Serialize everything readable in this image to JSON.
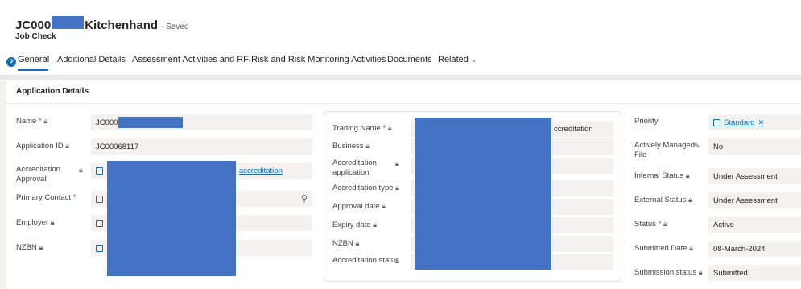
{
  "header": {
    "title_prefix": "JC000",
    "title_suffix": "Kitchenhand",
    "saved_status": "- Saved",
    "subtitle": "Job Check"
  },
  "tabs": [
    {
      "label": "General",
      "active": true
    },
    {
      "label": "Additional Details",
      "active": false
    },
    {
      "label": "Assessment Activities and RFI",
      "active": false
    },
    {
      "label": "Risk and Risk Monitoring Activities",
      "active": false
    },
    {
      "label": "Documents",
      "active": false
    },
    {
      "label": "Related",
      "active": false
    }
  ],
  "section": {
    "title": "Application Details"
  },
  "left_fields": {
    "name": {
      "label": "Name",
      "value": "JC000"
    },
    "application_id": {
      "label": "Application ID",
      "value": "JC00068117"
    },
    "accreditation_approval": {
      "label": "Accreditation Approval",
      "value": "accreditation"
    },
    "primary_contact": {
      "label": "Primary Contact"
    },
    "employer": {
      "label": "Employer"
    },
    "nzbn": {
      "label": "NZBN"
    }
  },
  "mid_fields": {
    "trading_name": {
      "label": "Trading Name",
      "value": "ccreditation"
    },
    "business": {
      "label": "Business"
    },
    "accreditation_application": {
      "label": "Accreditation application"
    },
    "accreditation_type": {
      "label": "Accreditation type"
    },
    "approval_date": {
      "label": "Approval date"
    },
    "expiry_date": {
      "label": "Expiry date"
    },
    "nzbn": {
      "label": "NZBN"
    },
    "accreditation_status": {
      "label": "Accreditation status"
    }
  },
  "right_fields": {
    "priority": {
      "label": "Priority",
      "value": "Standard"
    },
    "actively_managed": {
      "label": "Actively Managed File",
      "value": "No"
    },
    "internal_status": {
      "label": "Internal Status",
      "value": "Under Assessment"
    },
    "external_status": {
      "label": "External Status",
      "value": "Under Assessment"
    },
    "status": {
      "label": "Status",
      "value": "Active"
    },
    "submitted_date": {
      "label": "Submitted Date",
      "value": "08-March-2024"
    },
    "submission_status": {
      "label": "Submission status",
      "value": "Submitted"
    }
  },
  "colors": {
    "accent": "#0f6cbd",
    "redaction": "#4472c4",
    "required": "#c4314b"
  }
}
